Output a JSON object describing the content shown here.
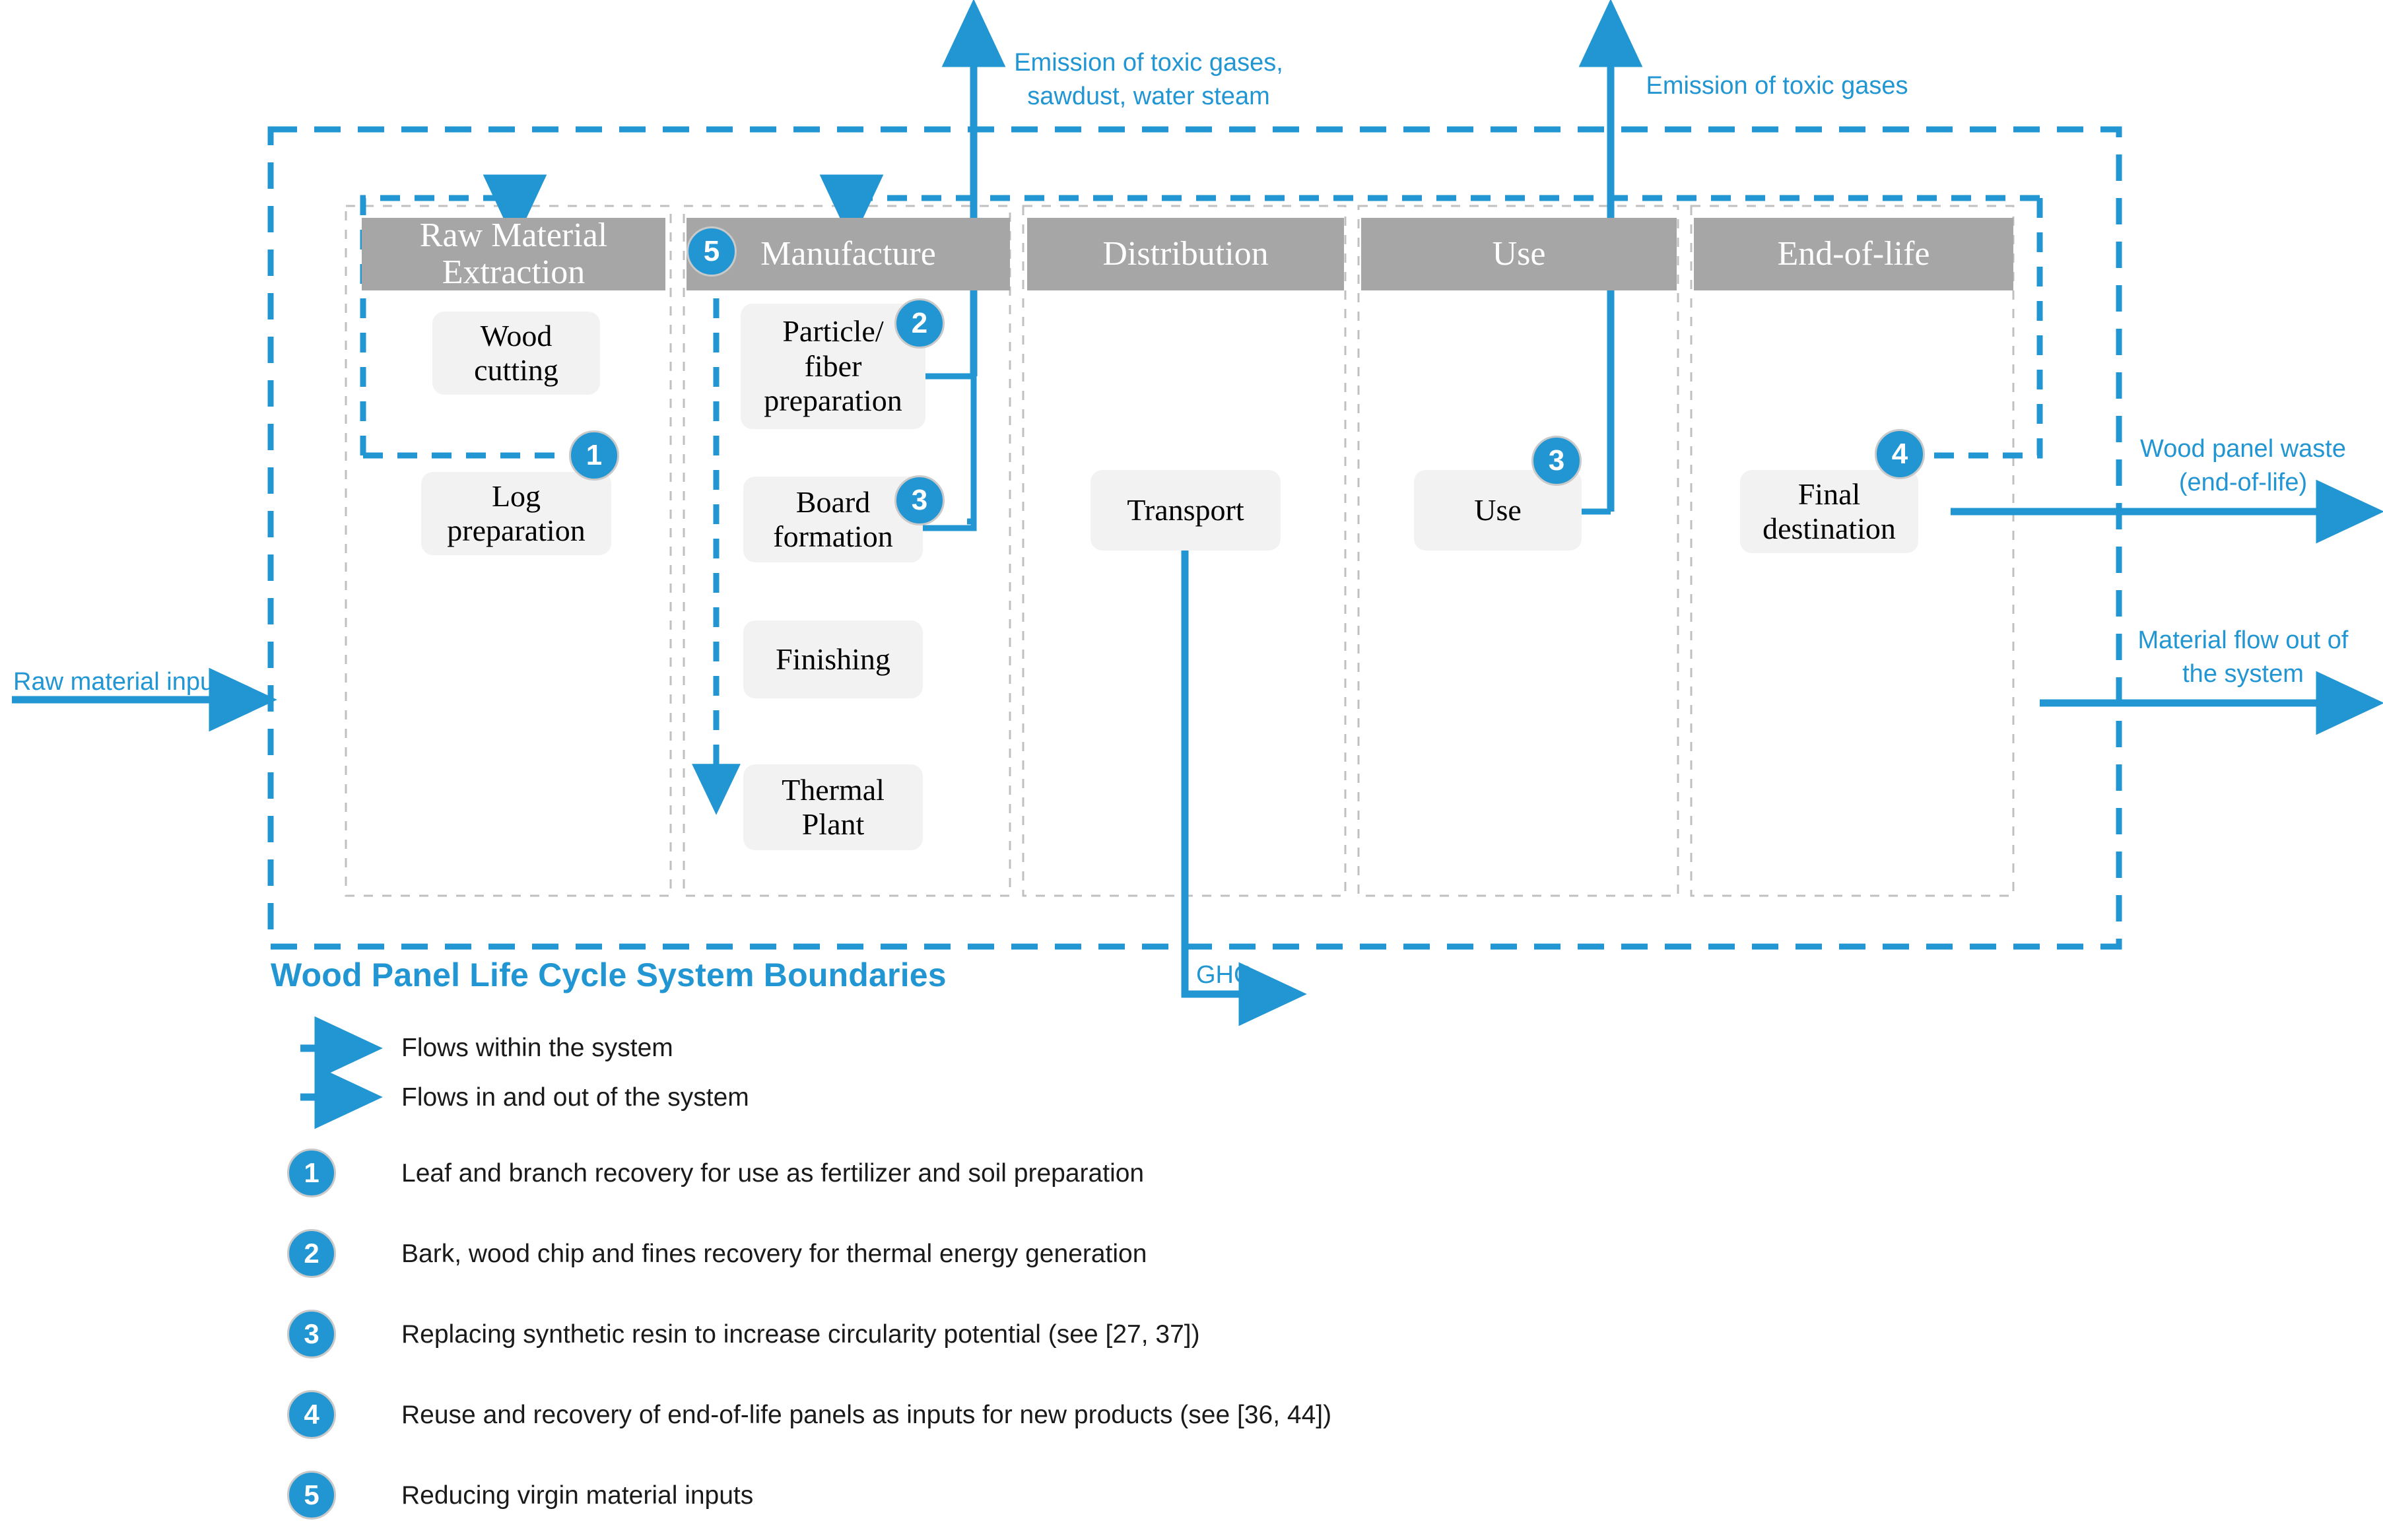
{
  "colors": {
    "accent": "#2196d3",
    "stage_header_bg": "#a6a6a6",
    "stage_header_text": "#ffffff",
    "process_box_bg": "#f2f2f2",
    "column_border": "#c0c0c0",
    "legend_text": "#1a1a1a"
  },
  "system_title": "Wood Panel Life Cycle System Boundaries",
  "stages": [
    {
      "id": "raw-material-extraction",
      "label": "Raw Material\nExtraction",
      "processes": [
        {
          "label": "Wood\ncutting"
        },
        {
          "label": "Log\npreparation"
        }
      ]
    },
    {
      "id": "manufacture",
      "label": "Manufacture",
      "processes": [
        {
          "label": "Particle/\nfiber\npreparation"
        },
        {
          "label": "Board\nformation"
        },
        {
          "label": "Finishing"
        },
        {
          "label": "Thermal\nPlant"
        }
      ]
    },
    {
      "id": "distribution",
      "label": "Distribution",
      "processes": [
        {
          "label": "Transport"
        }
      ]
    },
    {
      "id": "use",
      "label": "Use",
      "processes": [
        {
          "label": "Use"
        }
      ]
    },
    {
      "id": "end-of-life",
      "label": "End-of-life",
      "processes": [
        {
          "label": "Final\ndestination"
        }
      ]
    }
  ],
  "flow_labels": {
    "emission_manufacture_line1": "Emission of toxic gases,",
    "emission_manufacture_line2": "sawdust, water steam",
    "emission_use": "Emission of toxic gases",
    "raw_material_input": "Raw material input",
    "wood_panel_waste_line1": "Wood panel waste",
    "wood_panel_waste_line2": "(end-of-life)",
    "material_flow_out_line1": "Material flow out of",
    "material_flow_out_line2": "the system",
    "ghg": "GHG"
  },
  "badges_diagram": [
    {
      "n": "1"
    },
    {
      "n": "2"
    },
    {
      "n": "3"
    },
    {
      "n": "3b"
    },
    {
      "n": "4"
    },
    {
      "n": "5"
    }
  ],
  "badge_numbers": {
    "b1": "1",
    "b2": "2",
    "b3": "3",
    "b3_use": "3",
    "b4": "4",
    "b5": "5"
  },
  "legend": {
    "line_keys": [
      {
        "style": "dashed",
        "label": "Flows within the system"
      },
      {
        "style": "solid",
        "label": "Flows in and out of the system"
      }
    ],
    "numbered": [
      {
        "n": "1",
        "text": "Leaf and branch recovery for use as fertilizer and soil preparation"
      },
      {
        "n": "2",
        "text": "Bark, wood chip and fines recovery for thermal energy generation"
      },
      {
        "n": "3",
        "text": "Replacing synthetic resin to increase circularity potential (see [27, 37])"
      },
      {
        "n": "4",
        "text": "Reuse and recovery of end-of-life panels as inputs for new products (see [36, 44])"
      },
      {
        "n": "5",
        "text": "Reducing virgin material inputs"
      }
    ]
  }
}
